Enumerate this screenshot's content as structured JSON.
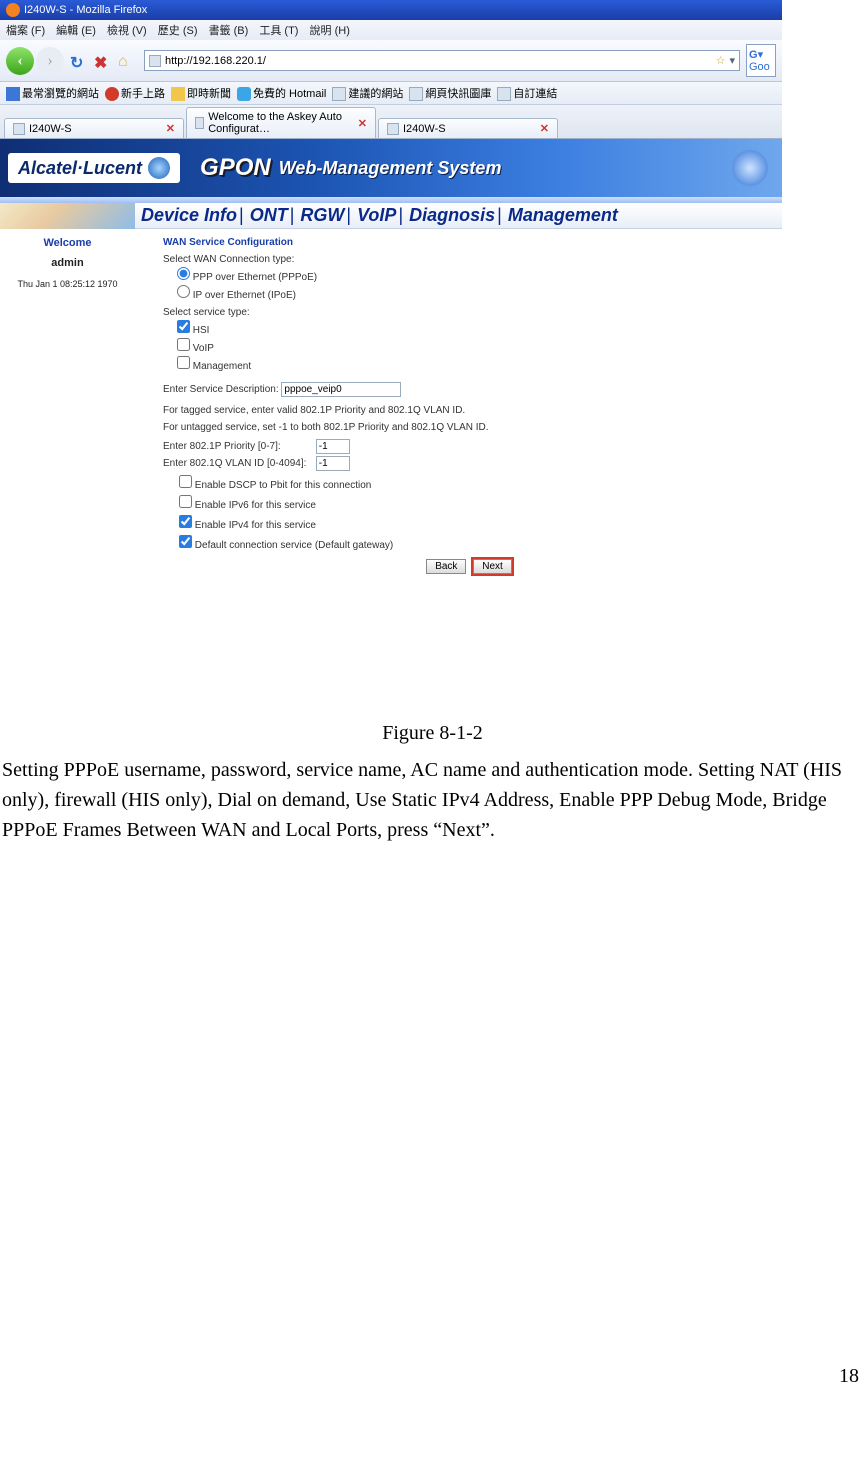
{
  "window": {
    "title": "I240W-S - Mozilla Firefox"
  },
  "menubar": [
    "檔案 (F)",
    "編輯 (E)",
    "檢視 (V)",
    "歷史 (S)",
    "書籤 (B)",
    "工具 (T)",
    "說明 (H)"
  ],
  "url": "http://192.168.220.1/",
  "searchbox": "Goo",
  "bookmarks": [
    "最常瀏覽的網站",
    "新手上路",
    "即時新聞",
    "免費的 Hotmail",
    "建議的網站",
    "網頁快訊圖庫",
    "自訂連結"
  ],
  "tabs": [
    {
      "label": "I240W-S",
      "closable": true
    },
    {
      "label": "Welcome to the Askey Auto Configurat…",
      "closable": true
    },
    {
      "label": "I240W-S",
      "closable": true
    }
  ],
  "banner": {
    "brand": "Alcatel·Lucent",
    "gpon": "GPON",
    "sub": "Web-Management System"
  },
  "sidebar": {
    "welcome": "Welcome",
    "user": "admin",
    "date": "Thu Jan 1 08:25:12 1970"
  },
  "navtabs": [
    "Device Info",
    "ONT",
    "RGW",
    "VoIP",
    "Diagnosis",
    "Management"
  ],
  "form": {
    "heading": "WAN Service Configuration",
    "conn_label": "Select WAN Connection type:",
    "conn_opts": [
      "PPP over Ethernet (PPPoE)",
      "IP over Ethernet (IPoE)"
    ],
    "svc_label": "Select service type:",
    "svc_opts": [
      "HSI",
      "VoIP",
      "Management"
    ],
    "desc_label": "Enter Service Description:",
    "desc_value": "pppoe_veip0",
    "hint1": "For tagged service, enter valid 802.1P Priority and 802.1Q VLAN ID.",
    "hint2": "For untagged service, set -1 to both 802.1P Priority and 802.1Q VLAN ID.",
    "prio_label": "Enter 802.1P Priority [0-7]:",
    "prio_value": "-1",
    "vlan_label": "Enter 802.1Q VLAN ID [0-4094]:",
    "vlan_value": "-1",
    "cb1": "Enable DSCP to Pbit for this connection",
    "cb2": "Enable IPv6 for this service",
    "cb3": "Enable IPv4 for this service",
    "cb4": "Default connection service (Default gateway)",
    "back": "Back",
    "next": "Next"
  },
  "caption": "Figure 8-1-2",
  "para": "Setting PPPoE username, password, service name, AC name and authentication mode. Setting NAT (HIS only), firewall (HIS only), Dial on demand, Use Static IPv4 Address, Enable PPP Debug Mode, Bridge PPPoE Frames Between WAN and Local Ports, press “Next”.",
  "pagenum": "18"
}
